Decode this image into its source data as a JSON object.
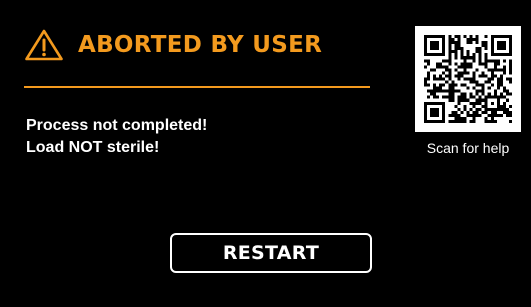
{
  "colors": {
    "background": "#000000",
    "accent": "#F39A1E",
    "text": "#FFFFFF",
    "qr_background": "#FFFFFF"
  },
  "status": {
    "icon": "warning-triangle-icon",
    "title": "ABORTED BY USER"
  },
  "messages": [
    "Process not completed!",
    "Load NOT sterile!"
  ],
  "help": {
    "icon": "qr-code-icon",
    "caption": "Scan for help"
  },
  "actions": {
    "restart_label": "RESTART"
  }
}
